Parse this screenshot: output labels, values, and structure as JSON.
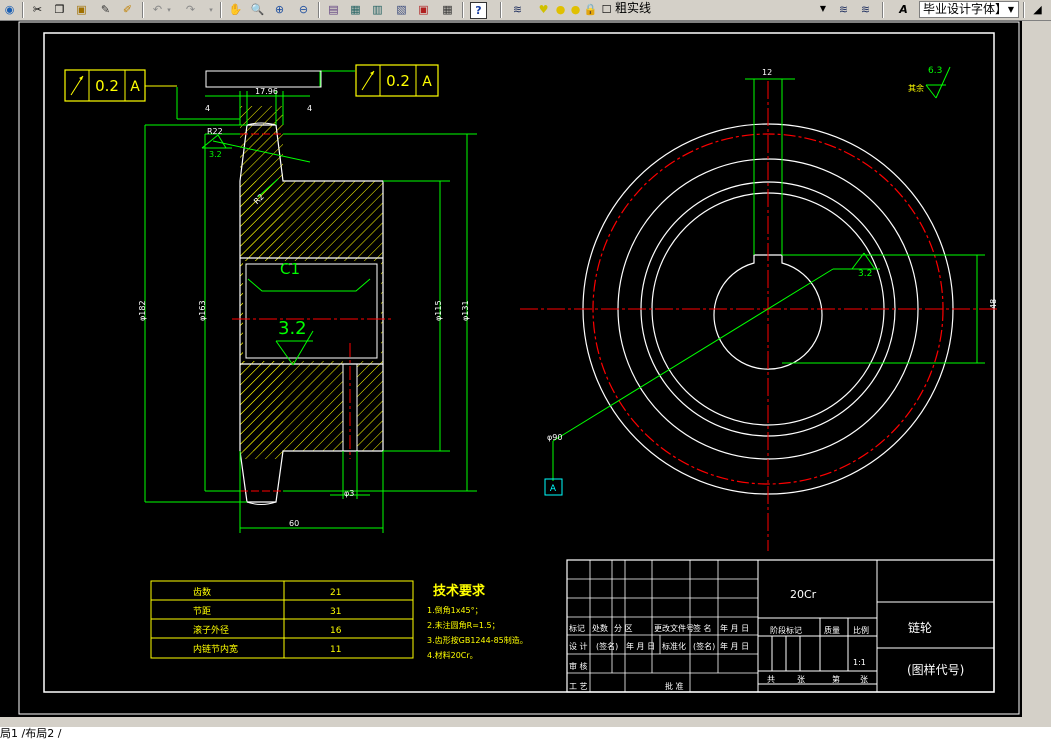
{
  "toolbar": {
    "icons": [
      "globe-icon",
      "cut-icon",
      "copy-icon",
      "paste-icon",
      "match-properties-icon",
      "undo-icon",
      "redo-icon",
      "pan-icon",
      "zoom-realtime-icon",
      "zoom-window-icon",
      "zoom-previous-icon",
      "properties-icon",
      "design-center-icon",
      "tool-palette-icon",
      "markup-icon",
      "quickcalc-icon",
      "help-icon",
      "layer-manager-icon",
      "layer-state-icon",
      "make-layer-current-icon",
      "layer-previous-icon",
      "text-style-icon"
    ],
    "layer_name": "粗实线",
    "text_style": "毕业设计字体】"
  },
  "tabs": {
    "label": "局1 /布局2 /"
  },
  "drawing": {
    "colors": {
      "white": "#ffffff",
      "yellow": "#ffff00",
      "green": "#00ff00",
      "red": "#ff0000",
      "cyan": "#00ffff"
    },
    "fcf_left": {
      "tol": "0.2",
      "datum": "A"
    },
    "fcf_right": {
      "tol": "0.2",
      "datum": "A"
    },
    "dims": {
      "width_top": "17.96",
      "left4": "4",
      "right4": "4",
      "chamfer_r": "R22",
      "r_small": "R2",
      "d1": "φ182",
      "d2": "φ163",
      "d3": "φ115",
      "d4": "φ131",
      "bore_w": "φ3",
      "width60": "60",
      "key12": "12",
      "key48": "48",
      "phi90": "φ90"
    },
    "rough": {
      "r_left": "3.2",
      "r_center": "3.2",
      "r_right": "3.2",
      "others_val": "6.3",
      "others_label": "其余"
    },
    "chamfer_label": "C1",
    "datum_label": "A",
    "params": [
      {
        "k": "齿数",
        "v": "21"
      },
      {
        "k": "节距",
        "v": "31"
      },
      {
        "k": "滚子外径",
        "v": "16"
      },
      {
        "k": "内链节内宽",
        "v": "11"
      }
    ],
    "tech": {
      "title": "技术要求",
      "lines": [
        "1.倒角1x45°；",
        "2.未注圆角R=1.5；",
        "3.齿形按GB1244-85制造。",
        "4.材料20Cr。"
      ]
    },
    "titleblock": {
      "material": "20Cr",
      "part_name": "链轮",
      "drawing_no": "(图样代号)",
      "row1": [
        "标记",
        "处数",
        "分 区",
        "更改文件号",
        "签 名",
        "年 月 日"
      ],
      "row2": [
        "设 计",
        "(签名)",
        "年 月 日",
        "标准化",
        "(签名)",
        "年 月 日"
      ],
      "row3": [
        "审 核"
      ],
      "row4": [
        "工 艺",
        "",
        "",
        "批 准"
      ],
      "stage": "阶段标记",
      "weight": "质量",
      "scale_label": "比例",
      "scale_val": "1:1",
      "sheets": [
        "共",
        "张",
        "第",
        "张"
      ]
    }
  }
}
